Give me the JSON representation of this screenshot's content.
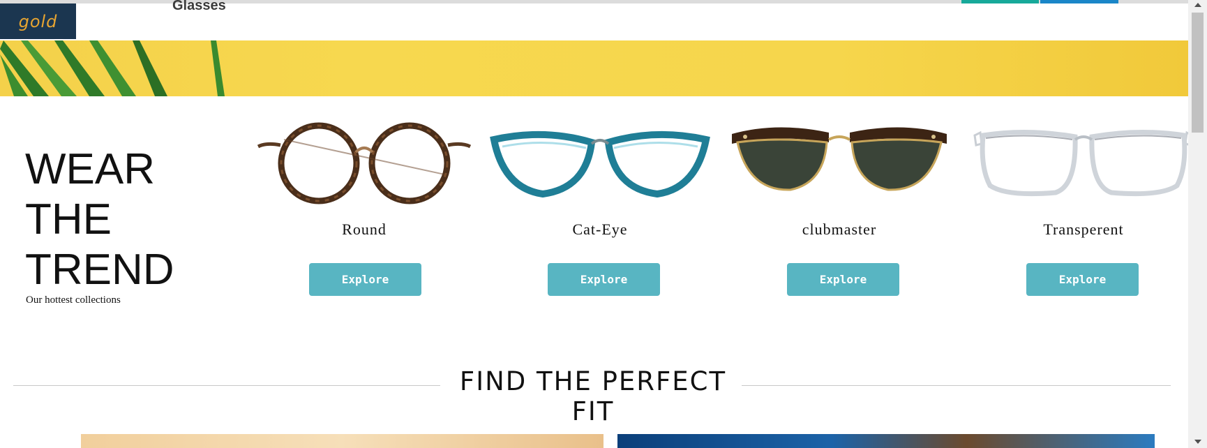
{
  "header": {
    "logo_text": "gold",
    "nav_item": "Glasses"
  },
  "trend": {
    "title": "WEAR THE TREND",
    "subtitle": "Our hottest collections"
  },
  "collections": [
    {
      "name": "Round",
      "button_label": "Explore"
    },
    {
      "name": "Cat-Eye",
      "button_label": "Explore"
    },
    {
      "name": "clubmaster",
      "button_label": "Explore"
    },
    {
      "name": "Transperent",
      "button_label": "Explore"
    }
  ],
  "fit_section": {
    "heading": "FIND THE PERFECT FIT"
  },
  "colors": {
    "logo_bg": "#1b3650",
    "logo_text": "#e8a531",
    "explore_button": "#58b5c2",
    "banner_yellow": "#f6d64c"
  }
}
